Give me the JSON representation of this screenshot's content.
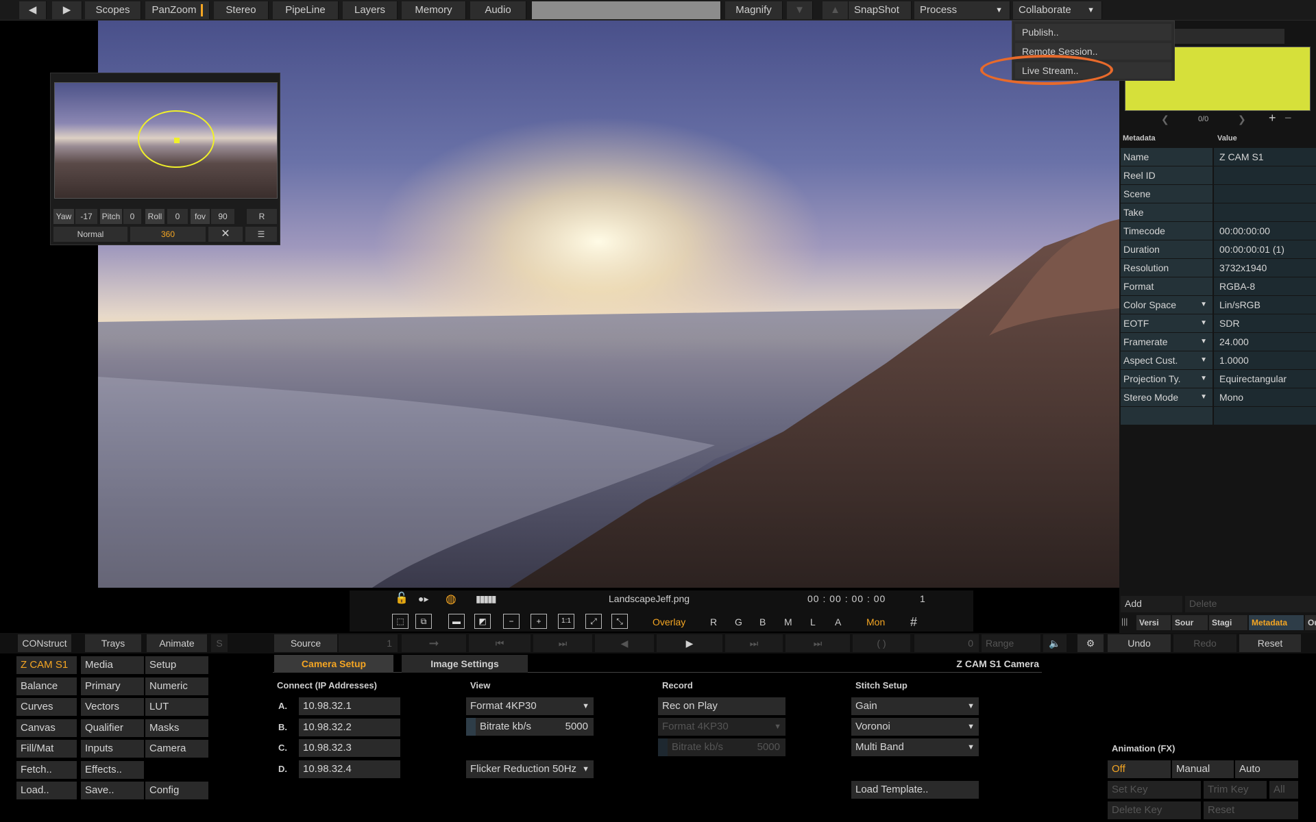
{
  "toolbar": {
    "items": [
      "Scopes",
      "PanZoom",
      "Stereo",
      "PipeLine",
      "Layers",
      "Memory",
      "Audio"
    ],
    "magnify": "Magnify",
    "snapshot": "SnapShot",
    "process": "Process",
    "collaborate": "Collaborate"
  },
  "collab_menu": [
    "Publish..",
    "Remote Session..",
    "Live Stream.."
  ],
  "panzoom": {
    "yaw_label": "Yaw",
    "yaw": "-17",
    "pitch_label": "Pitch",
    "pitch": "0",
    "roll_label": "Roll",
    "roll": "0",
    "fov_label": "fov",
    "fov": "90",
    "reset": "R",
    "mode_normal": "Normal",
    "mode_360": "360"
  },
  "right": {
    "counter": "0/0",
    "meta_header": "Metadata",
    "value_header": "Value",
    "rows": [
      {
        "key": "Name",
        "value": "Z CAM S1",
        "drop": ""
      },
      {
        "key": "Reel ID",
        "value": "",
        "drop": ""
      },
      {
        "key": "Scene",
        "value": "",
        "drop": ""
      },
      {
        "key": "Take",
        "value": "",
        "drop": ""
      },
      {
        "key": "Timecode",
        "value": "00:00:00:00",
        "drop": ""
      },
      {
        "key": "Duration",
        "value": "00:00:00:01 (1)",
        "drop": ""
      },
      {
        "key": "Resolution",
        "value": "3732x1940",
        "drop": ""
      },
      {
        "key": "Format",
        "value": "RGBA-8",
        "drop": ""
      },
      {
        "key": "Color Space",
        "value": "Lin/sRGB",
        "drop": "▼"
      },
      {
        "key": "EOTF",
        "value": "SDR",
        "drop": "▼"
      },
      {
        "key": "Framerate",
        "value": "24.000",
        "drop": "▼"
      },
      {
        "key": "Aspect Cust.",
        "value": "1.0000",
        "drop": "▼"
      },
      {
        "key": "Projection Ty.",
        "value": "Equirectangular",
        "drop": "▼"
      },
      {
        "key": "Stereo Mode",
        "value": "Mono",
        "drop": "▼"
      }
    ],
    "add": "Add",
    "delete": "Delete",
    "tabs": [
      "Versi",
      "Sour",
      "Stagi",
      "Metadata",
      "Outpu"
    ]
  },
  "infobar": {
    "filename": "LandscapeJeff.png",
    "timecode": "00 : 00 : 00 : 00",
    "frame": "1",
    "overlay": "Overlay",
    "letters": [
      "R",
      "G",
      "B",
      "M",
      "L",
      "A"
    ],
    "mon": "Mon"
  },
  "bottom_nav": {
    "construct": "CONstruct",
    "trays": "Trays",
    "animate": "Animate",
    "s": "S",
    "source": "Source",
    "source_frame": "1",
    "counter": "0",
    "range": "Range",
    "undo": "Undo",
    "redo": "Redo",
    "reset": "Reset"
  },
  "menu": {
    "col1": [
      "Z CAM S1",
      "Balance",
      "Curves",
      "Canvas",
      "Fill/Mat",
      "Fetch..",
      "Load.."
    ],
    "col2": [
      "Media",
      "Primary",
      "Vectors",
      "Qualifier",
      "Inputs",
      "Effects..",
      "Save.."
    ],
    "col3": [
      "Setup",
      "Numeric",
      "LUT",
      "Masks",
      "Camera",
      "",
      "Config"
    ]
  },
  "camera": {
    "tab_setup": "Camera Setup",
    "tab_image": "Image Settings",
    "title": "Z CAM S1 Camera",
    "connect_title": "Connect (IP Addresses)",
    "ips": [
      {
        "label": "A.",
        "ip": "10.98.32.1"
      },
      {
        "label": "B.",
        "ip": "10.98.32.2"
      },
      {
        "label": "C.",
        "ip": "10.98.32.3"
      },
      {
        "label": "D.",
        "ip": "10.98.32.4"
      }
    ],
    "view_title": "View",
    "view_format": "Format 4KP30",
    "view_bitrate_label": "Bitrate kb/s",
    "view_bitrate": "5000",
    "flicker": "Flicker Reduction 50Hz",
    "record_title": "Record",
    "rec_on_play": "Rec on Play",
    "rec_format": "Format 4KP30",
    "rec_bitrate_label": "Bitrate kb/s",
    "rec_bitrate": "5000",
    "stitch_title": "Stitch Setup",
    "stitch": [
      "Gain",
      "Voronoi",
      "Multi Band"
    ],
    "load_template": "Load Template.."
  },
  "animation": {
    "title": "Animation (FX)",
    "off": "Off",
    "manual": "Manual",
    "auto": "Auto",
    "set_key": "Set Key",
    "trim_key": "Trim Key",
    "all": "All",
    "delete_key": "Delete Key",
    "reset": "Reset"
  },
  "colors": {
    "accent": "#f5a623",
    "highlight": "#e86a2b",
    "swatch": "#d6e03a"
  }
}
